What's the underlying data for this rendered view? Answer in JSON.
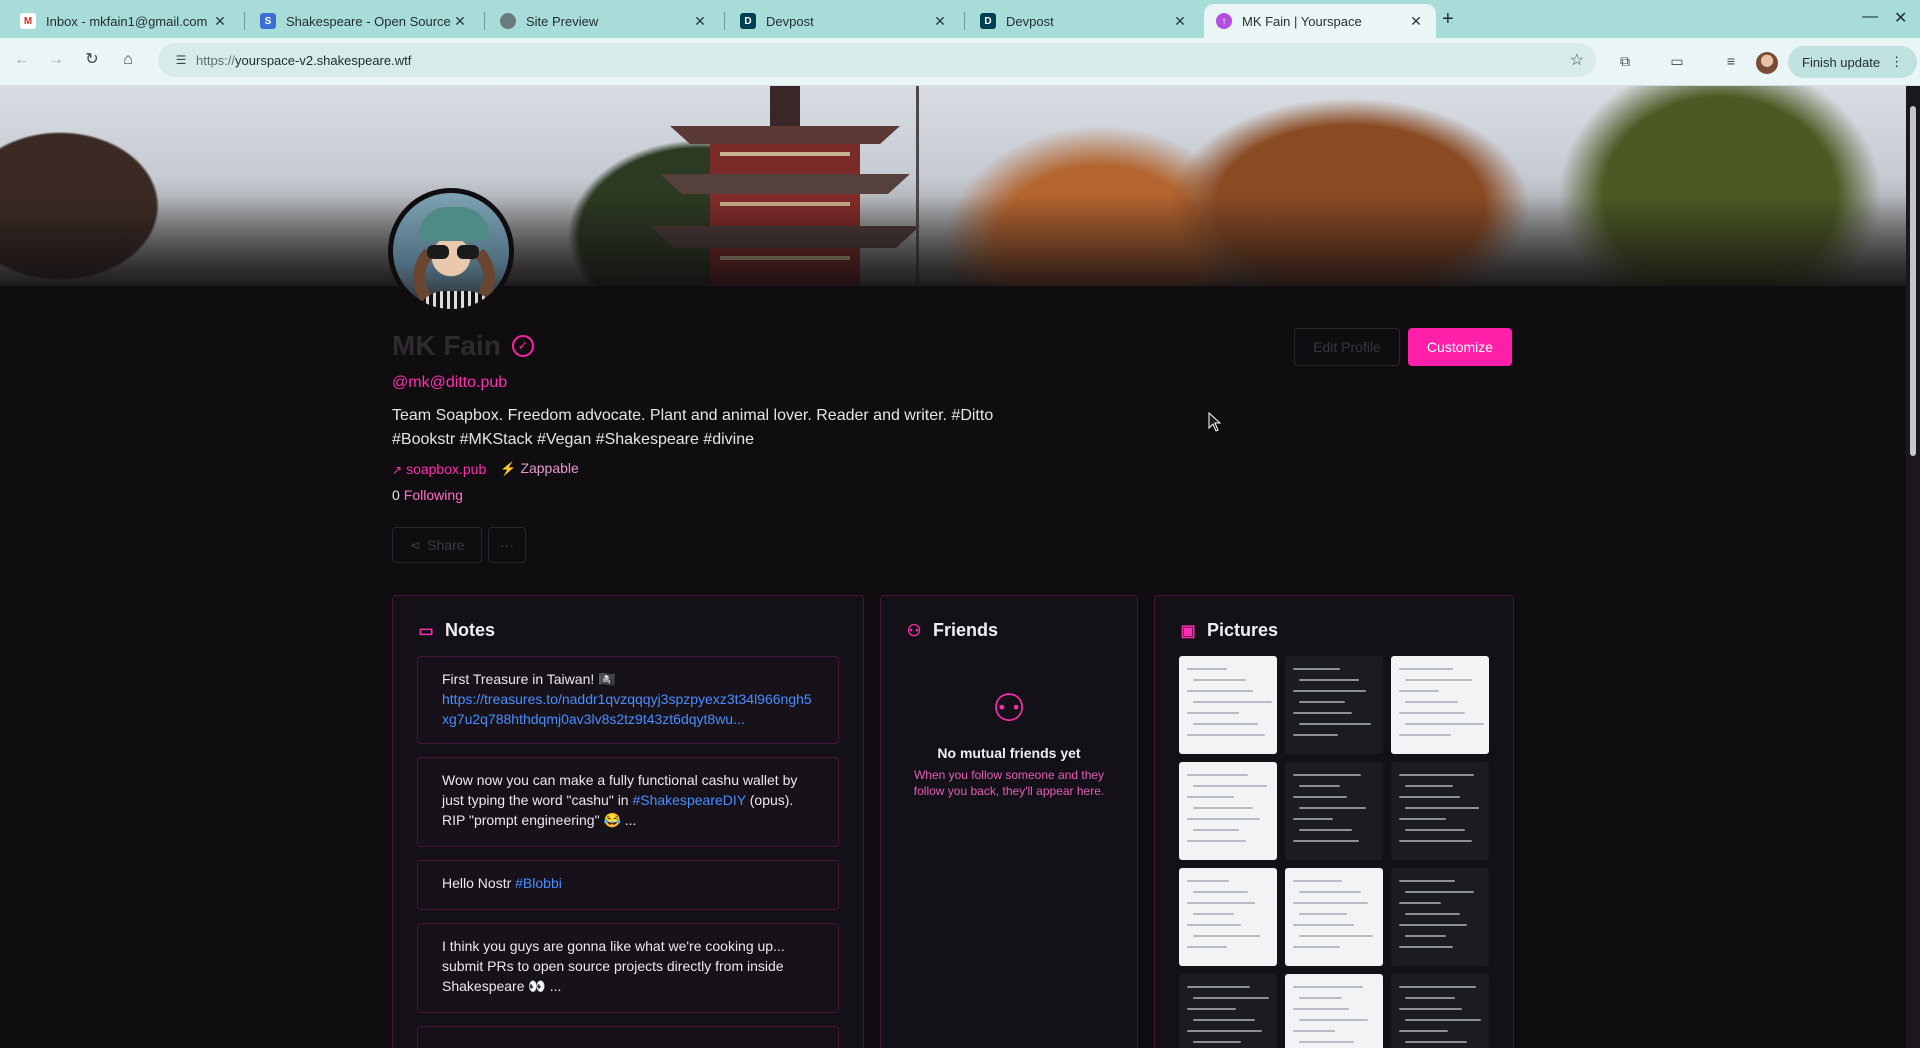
{
  "browser": {
    "tabs": [
      {
        "label": "Inbox - mkfain1@gmail.com",
        "favicon": "gmail-icon",
        "color": "#d93025"
      },
      {
        "label": "Shakespeare - Open Source",
        "favicon": "shakespeare-icon",
        "color": "#3b6fd6"
      },
      {
        "label": "Site Preview",
        "favicon": "globe-icon",
        "color": "#5f6f6f"
      },
      {
        "label": "Devpost",
        "favicon": "devpost-icon",
        "color": "#003e54"
      },
      {
        "label": "Devpost",
        "favicon": "devpost-icon",
        "color": "#003e54"
      },
      {
        "label": "MK Fain | Yourspace",
        "favicon": "yourspace-icon",
        "color": "#b44ee0"
      }
    ],
    "url": {
      "scheme": "https://",
      "host": "yourspace-v2.shakespeare.wtf"
    },
    "finish_update": "Finish update"
  },
  "profile": {
    "name": "MK Fain",
    "handle": "@mk@ditto.pub",
    "bio": "Team Soapbox. Freedom advocate. Plant and animal lover. Reader and writer. #Ditto #Bookstr #MKStack #Vegan #Shakespeare #divine",
    "website": "soapbox.pub",
    "zappable": "Zappable",
    "following_count": "0",
    "following_label": "Following",
    "edit_profile": "Edit Profile",
    "customize": "Customize",
    "share": "Share",
    "more": "···",
    "accent": "#ff1fa8"
  },
  "notes": {
    "title": "Notes",
    "items": [
      {
        "text": "First Treasure in Taiwan! 🏴‍☠️",
        "link": "https://treasures.to/naddr1qvzqqqyj3spzpyexz3t34l966ngh5xg7u2q788hthdqmj0av3lv8s2tz9t43zt6dqyt8wu..."
      },
      {
        "text_before": "Wow now you can make a fully functional cashu wallet by just typing the word \"cashu\" in ",
        "tag": "#ShakespeareDIY",
        "text_after": " (opus). RIP \"prompt engineering\" 😂 ..."
      },
      {
        "text_before": "Hello Nostr ",
        "tag": "#Blobbi"
      },
      {
        "text": "I think you guys are gonna like what we're cooking up... submit PRs to open source projects directly from inside Shakespeare 👀 ..."
      }
    ]
  },
  "friends": {
    "title": "Friends",
    "empty_title": "No mutual friends yet",
    "empty_text": "When you follow someone and they follow you back, they'll appear here."
  },
  "pictures": {
    "title": "Pictures",
    "thumbs": [
      "light",
      "dark",
      "light",
      "light",
      "dark",
      "dark",
      "light",
      "light",
      "dark",
      "dark",
      "light",
      "dark"
    ]
  }
}
